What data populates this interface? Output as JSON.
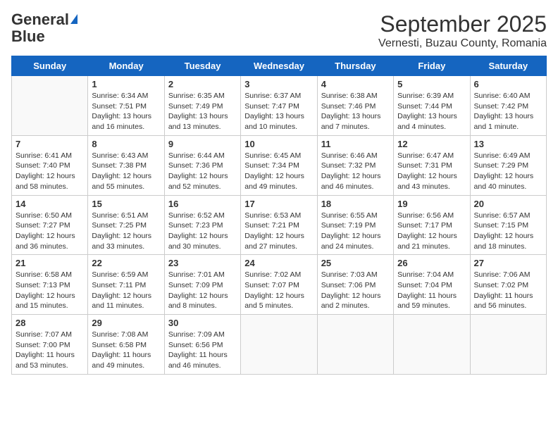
{
  "logo": {
    "line1": "General",
    "line2": "Blue"
  },
  "title": "September 2025",
  "subtitle": "Vernesti, Buzau County, Romania",
  "days_of_week": [
    "Sunday",
    "Monday",
    "Tuesday",
    "Wednesday",
    "Thursday",
    "Friday",
    "Saturday"
  ],
  "weeks": [
    [
      {
        "day": "",
        "info": ""
      },
      {
        "day": "1",
        "info": "Sunrise: 6:34 AM\nSunset: 7:51 PM\nDaylight: 13 hours\nand 16 minutes."
      },
      {
        "day": "2",
        "info": "Sunrise: 6:35 AM\nSunset: 7:49 PM\nDaylight: 13 hours\nand 13 minutes."
      },
      {
        "day": "3",
        "info": "Sunrise: 6:37 AM\nSunset: 7:47 PM\nDaylight: 13 hours\nand 10 minutes."
      },
      {
        "day": "4",
        "info": "Sunrise: 6:38 AM\nSunset: 7:46 PM\nDaylight: 13 hours\nand 7 minutes."
      },
      {
        "day": "5",
        "info": "Sunrise: 6:39 AM\nSunset: 7:44 PM\nDaylight: 13 hours\nand 4 minutes."
      },
      {
        "day": "6",
        "info": "Sunrise: 6:40 AM\nSunset: 7:42 PM\nDaylight: 13 hours\nand 1 minute."
      }
    ],
    [
      {
        "day": "7",
        "info": "Sunrise: 6:41 AM\nSunset: 7:40 PM\nDaylight: 12 hours\nand 58 minutes."
      },
      {
        "day": "8",
        "info": "Sunrise: 6:43 AM\nSunset: 7:38 PM\nDaylight: 12 hours\nand 55 minutes."
      },
      {
        "day": "9",
        "info": "Sunrise: 6:44 AM\nSunset: 7:36 PM\nDaylight: 12 hours\nand 52 minutes."
      },
      {
        "day": "10",
        "info": "Sunrise: 6:45 AM\nSunset: 7:34 PM\nDaylight: 12 hours\nand 49 minutes."
      },
      {
        "day": "11",
        "info": "Sunrise: 6:46 AM\nSunset: 7:32 PM\nDaylight: 12 hours\nand 46 minutes."
      },
      {
        "day": "12",
        "info": "Sunrise: 6:47 AM\nSunset: 7:31 PM\nDaylight: 12 hours\nand 43 minutes."
      },
      {
        "day": "13",
        "info": "Sunrise: 6:49 AM\nSunset: 7:29 PM\nDaylight: 12 hours\nand 40 minutes."
      }
    ],
    [
      {
        "day": "14",
        "info": "Sunrise: 6:50 AM\nSunset: 7:27 PM\nDaylight: 12 hours\nand 36 minutes."
      },
      {
        "day": "15",
        "info": "Sunrise: 6:51 AM\nSunset: 7:25 PM\nDaylight: 12 hours\nand 33 minutes."
      },
      {
        "day": "16",
        "info": "Sunrise: 6:52 AM\nSunset: 7:23 PM\nDaylight: 12 hours\nand 30 minutes."
      },
      {
        "day": "17",
        "info": "Sunrise: 6:53 AM\nSunset: 7:21 PM\nDaylight: 12 hours\nand 27 minutes."
      },
      {
        "day": "18",
        "info": "Sunrise: 6:55 AM\nSunset: 7:19 PM\nDaylight: 12 hours\nand 24 minutes."
      },
      {
        "day": "19",
        "info": "Sunrise: 6:56 AM\nSunset: 7:17 PM\nDaylight: 12 hours\nand 21 minutes."
      },
      {
        "day": "20",
        "info": "Sunrise: 6:57 AM\nSunset: 7:15 PM\nDaylight: 12 hours\nand 18 minutes."
      }
    ],
    [
      {
        "day": "21",
        "info": "Sunrise: 6:58 AM\nSunset: 7:13 PM\nDaylight: 12 hours\nand 15 minutes."
      },
      {
        "day": "22",
        "info": "Sunrise: 6:59 AM\nSunset: 7:11 PM\nDaylight: 12 hours\nand 11 minutes."
      },
      {
        "day": "23",
        "info": "Sunrise: 7:01 AM\nSunset: 7:09 PM\nDaylight: 12 hours\nand 8 minutes."
      },
      {
        "day": "24",
        "info": "Sunrise: 7:02 AM\nSunset: 7:07 PM\nDaylight: 12 hours\nand 5 minutes."
      },
      {
        "day": "25",
        "info": "Sunrise: 7:03 AM\nSunset: 7:06 PM\nDaylight: 12 hours\nand 2 minutes."
      },
      {
        "day": "26",
        "info": "Sunrise: 7:04 AM\nSunset: 7:04 PM\nDaylight: 11 hours\nand 59 minutes."
      },
      {
        "day": "27",
        "info": "Sunrise: 7:06 AM\nSunset: 7:02 PM\nDaylight: 11 hours\nand 56 minutes."
      }
    ],
    [
      {
        "day": "28",
        "info": "Sunrise: 7:07 AM\nSunset: 7:00 PM\nDaylight: 11 hours\nand 53 minutes."
      },
      {
        "day": "29",
        "info": "Sunrise: 7:08 AM\nSunset: 6:58 PM\nDaylight: 11 hours\nand 49 minutes."
      },
      {
        "day": "30",
        "info": "Sunrise: 7:09 AM\nSunset: 6:56 PM\nDaylight: 11 hours\nand 46 minutes."
      },
      {
        "day": "",
        "info": ""
      },
      {
        "day": "",
        "info": ""
      },
      {
        "day": "",
        "info": ""
      },
      {
        "day": "",
        "info": ""
      }
    ]
  ]
}
